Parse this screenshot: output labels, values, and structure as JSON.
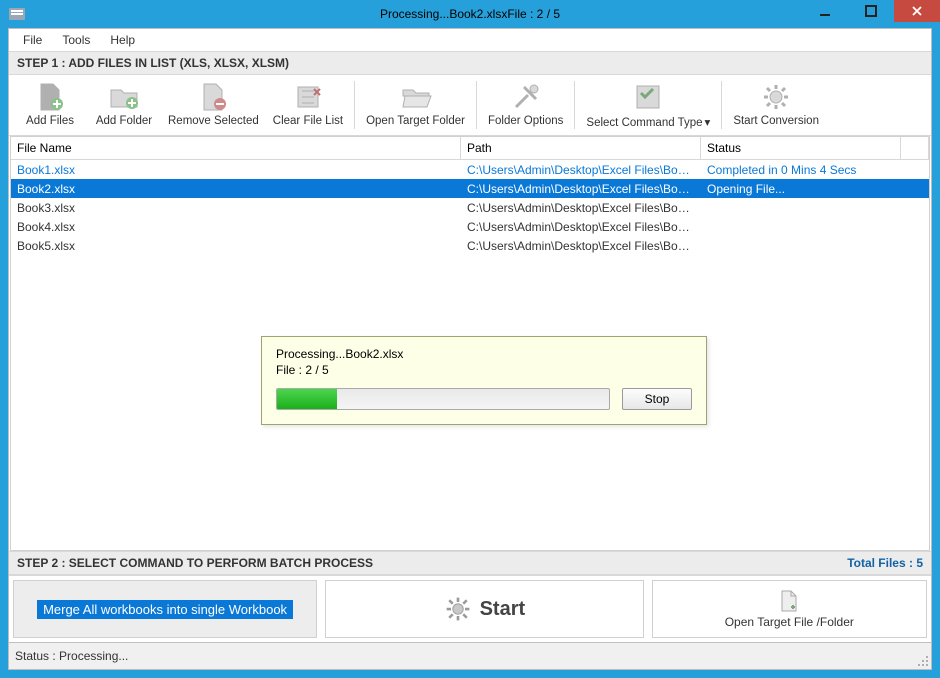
{
  "title": "Processing...Book2.xlsxFile : 2 / 5",
  "menu": {
    "file": "File",
    "tools": "Tools",
    "help": "Help"
  },
  "step1": {
    "header": "STEP 1 : ADD FILES IN LIST (XLS, XLSX, XLSM)"
  },
  "toolbar": {
    "add_files": "Add Files",
    "add_folder": "Add Folder",
    "remove_selected": "Remove Selected",
    "clear_list": "Clear File List",
    "open_target": "Open Target Folder",
    "folder_options": "Folder Options",
    "select_command": "Select Command Type",
    "start_conversion": "Start Conversion"
  },
  "columns": {
    "name": "File Name",
    "path": "Path",
    "status": "Status"
  },
  "files": [
    {
      "name": "Book1.xlsx",
      "path": "C:\\Users\\Admin\\Desktop\\Excel Files\\Book...",
      "status": "Completed in 0 Mins 4 Secs",
      "style": "link"
    },
    {
      "name": "Book2.xlsx",
      "path": "C:\\Users\\Admin\\Desktop\\Excel Files\\Book...",
      "status": "Opening File...",
      "style": "selected"
    },
    {
      "name": "Book3.xlsx",
      "path": "C:\\Users\\Admin\\Desktop\\Excel Files\\Book...",
      "status": "",
      "style": ""
    },
    {
      "name": "Book4.xlsx",
      "path": "C:\\Users\\Admin\\Desktop\\Excel Files\\Book...",
      "status": "",
      "style": ""
    },
    {
      "name": "Book5.xlsx",
      "path": "C:\\Users\\Admin\\Desktop\\Excel Files\\Book...",
      "status": "",
      "style": ""
    }
  ],
  "step2": {
    "header": "STEP 2 : SELECT COMMAND TO PERFORM BATCH PROCESS",
    "total_files_label": "Total Files : 5",
    "mode_label": "Merge All workbooks into single Workbook",
    "start_label": "Start",
    "open_target_label": "Open Target File /Folder"
  },
  "status": {
    "text": "Status  :  Processing..."
  },
  "progress": {
    "line1": "Processing...Book2.xlsx",
    "line2": "File : 2 / 5",
    "percent": 18,
    "stop": "Stop"
  }
}
